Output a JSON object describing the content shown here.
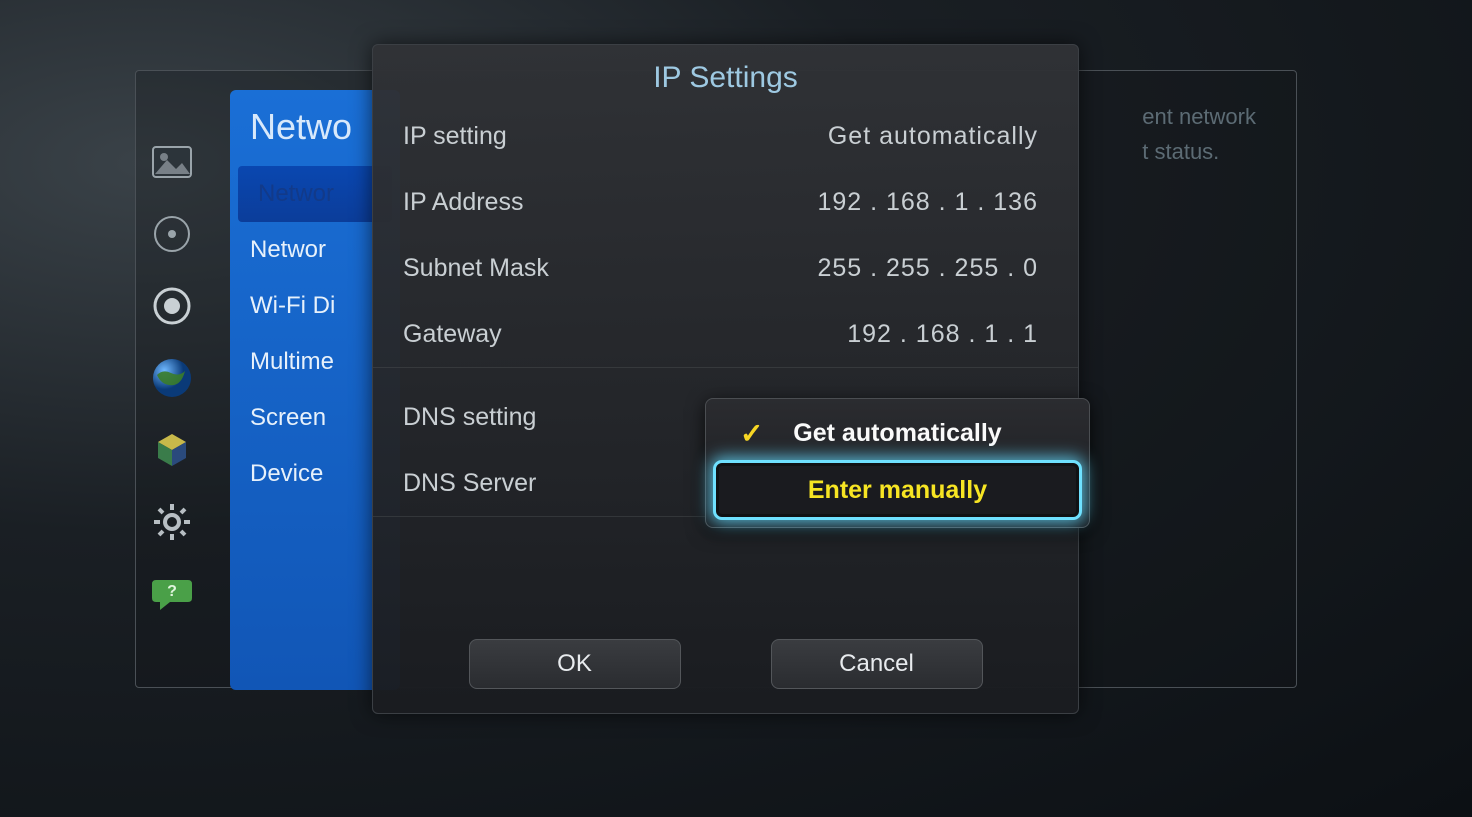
{
  "back_panel": {
    "line1": "ent network",
    "line2": "t status."
  },
  "sidebar": {
    "title": "Netwo",
    "items": [
      "Networ",
      "Networ",
      "Wi-Fi Di",
      "Multime",
      "Screen",
      "Device"
    ]
  },
  "modal": {
    "title": "IP Settings",
    "rows": {
      "ip_setting": {
        "label": "IP setting",
        "value": "Get automatically"
      },
      "ip_address": {
        "label": "IP Address",
        "value": "192 . 168 . 1 . 136"
      },
      "subnet_mask": {
        "label": "Subnet Mask",
        "value": "255 . 255 . 255 . 0"
      },
      "gateway": {
        "label": "Gateway",
        "value": "192 . 168 . 1 . 1"
      },
      "dns_setting": {
        "label": "DNS setting",
        "value": ""
      },
      "dns_server": {
        "label": "DNS Server",
        "value": ""
      }
    },
    "buttons": {
      "ok": "OK",
      "cancel": "Cancel"
    }
  },
  "dropdown": {
    "option_auto": "Get automatically",
    "option_manual": "Enter manually"
  }
}
